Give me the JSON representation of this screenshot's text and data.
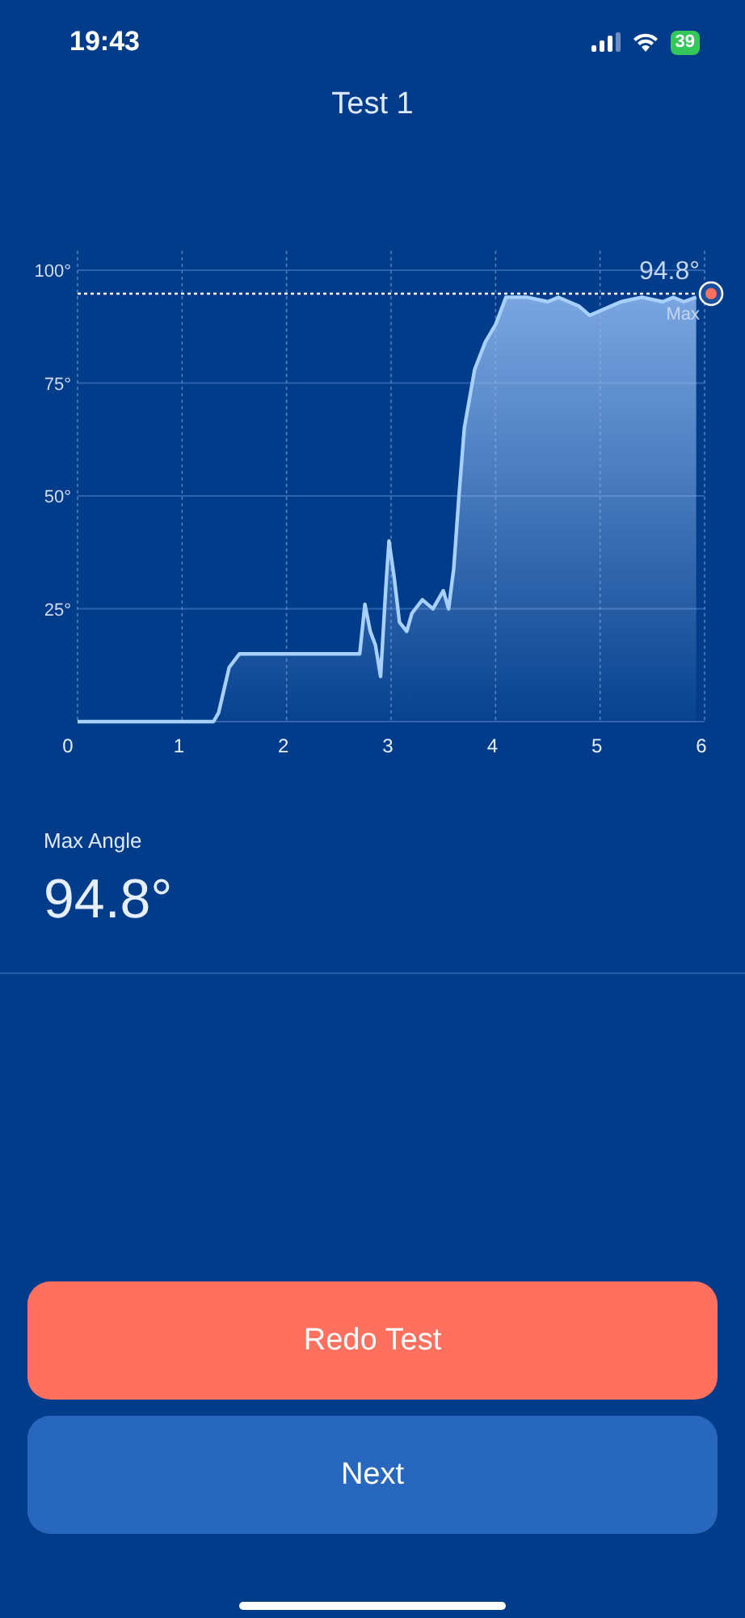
{
  "status_bar": {
    "time": "19:43",
    "battery": "39"
  },
  "title": "Test 1",
  "chart_data": {
    "type": "area",
    "x": [
      0,
      1.3,
      1.35,
      1.45,
      1.55,
      1.65,
      2.7,
      2.75,
      2.8,
      2.85,
      2.9,
      2.95,
      2.98,
      3.03,
      3.08,
      3.15,
      3.2,
      3.3,
      3.4,
      3.5,
      3.55,
      3.6,
      3.65,
      3.7,
      3.8,
      3.9,
      4.0,
      4.1,
      4.2,
      4.3,
      4.5,
      4.6,
      4.8,
      4.9,
      5.0,
      5.2,
      5.4,
      5.6,
      5.7,
      5.8,
      5.92
    ],
    "series": [
      {
        "color": "#a8d0ff",
        "values": [
          0,
          0,
          2,
          12,
          15,
          15,
          15,
          26,
          20,
          17,
          10,
          30,
          40,
          32,
          22,
          20,
          24,
          27,
          25,
          29,
          25,
          34,
          50,
          65,
          78,
          84,
          88,
          94,
          94,
          94,
          93,
          94,
          92,
          90,
          91,
          93,
          94,
          93,
          94,
          93,
          94
        ]
      }
    ],
    "xlim": [
      0,
      6
    ],
    "ylim": [
      0,
      100
    ],
    "grid": true,
    "xticks": [
      0,
      1,
      2,
      3,
      4,
      5,
      6
    ],
    "yticks": [
      {
        "value": 25,
        "label": "25°"
      },
      {
        "value": 50,
        "label": "50°"
      },
      {
        "value": 75,
        "label": "75°"
      },
      {
        "value": 100,
        "label": "100°"
      }
    ],
    "ref_lines": [
      {
        "axis": "y",
        "value": 94.8
      }
    ],
    "annotations": [
      {
        "text": "94.8°",
        "x": 6,
        "y": 94.8
      },
      {
        "text": "Max",
        "x": 6,
        "y": 94.8
      }
    ]
  },
  "max_angle": {
    "label": "Max Angle",
    "value": "94.8°"
  },
  "buttons": [
    {
      "label": "Redo Test",
      "kind": "primary"
    },
    {
      "label": "Next",
      "kind": "secondary"
    }
  ]
}
